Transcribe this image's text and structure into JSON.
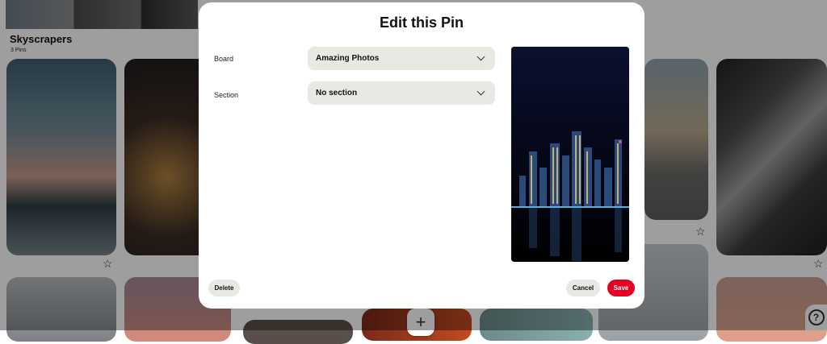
{
  "board": {
    "title": "Skyscrapers",
    "pin_count": "3 Pins"
  },
  "modal": {
    "title": "Edit this Pin",
    "board_label": "Board",
    "board_value": "Amazing Photos",
    "section_label": "Section",
    "section_value": "No section",
    "delete_label": "Delete",
    "cancel_label": "Cancel",
    "save_label": "Save"
  },
  "controls": {
    "add_symbol": "+",
    "help_symbol": "?",
    "star_symbol": "☆"
  },
  "colors": {
    "save": "#e60023",
    "field_bg": "#e9e9e4"
  }
}
